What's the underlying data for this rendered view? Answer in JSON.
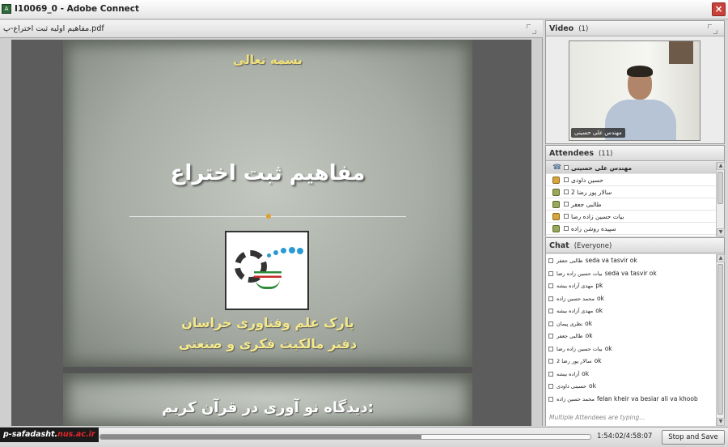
{
  "window": {
    "title": "I10069_0 - Adobe Connect",
    "icon": "adobe-connect-icon",
    "close_label": "×"
  },
  "share_pod": {
    "title": "مفاهیم اولیه ثبت اختراع-پ.pdf",
    "slide1": {
      "bismillah": "بسمه تعالی",
      "title": "مفاهیم ثبت اختراع",
      "org_line1": "پارک علم وفناوری خراسان",
      "org_line2": "دفتر مالکیت فکری و صنعتی"
    },
    "slide2": {
      "title": "دیدگاه نو آوری در قرآن کریم:"
    }
  },
  "video_pod": {
    "title": "Video",
    "count": "(1)",
    "video_label": "مهندس علی حسینی"
  },
  "attendees_pod": {
    "title": "Attendees",
    "count": "(11)",
    "items": [
      {
        "name": "مهندس علی حسینی",
        "icon": "phone-icon",
        "host": true
      },
      {
        "name": "حسین داودی",
        "icon": "user-icon"
      },
      {
        "name": "سالار پور رضا 2",
        "icon": "camera-user-icon"
      },
      {
        "name": "طالبی جعفر",
        "icon": "camera-user-icon"
      },
      {
        "name": "بیات حسین زاده رضا",
        "icon": "user-icon"
      },
      {
        "name": "سپیده روشن زاده",
        "icon": "camera-user-icon"
      }
    ]
  },
  "chat_pod": {
    "title": "Chat",
    "scope": "(Everyone)",
    "messages": [
      {
        "name": "طالبی جعفر",
        "text": "seda va tasvir ok"
      },
      {
        "name": "بیات حسین زاده رضا",
        "text": "seda va tasvir  ok"
      },
      {
        "name": "مهدی آزاده بیشه",
        "text": "pk"
      },
      {
        "name": "محمد حسین زاده",
        "text": "ok"
      },
      {
        "name": "مهدی آزاده بیشه",
        "text": "ok"
      },
      {
        "name": "نظری پیمان",
        "text": "ok"
      },
      {
        "name": "طالبی جعفر",
        "text": "ok"
      },
      {
        "name": "بیات حسین زاده رضا",
        "text": "ok"
      },
      {
        "name": "سالار پور رضا 2",
        "text": "ok"
      },
      {
        "name": "آزاده بیشه",
        "text": "ok"
      },
      {
        "name": "حسینی داودی",
        "text": "ok"
      },
      {
        "name": "محمد حسین زاده",
        "text": "felan kheir va besiar ali va khoob"
      }
    ],
    "typing_status": "Multiple Attendees are typing..."
  },
  "status_bar": {
    "watermark_user": "p-safadasht.",
    "watermark_domain": "nus.ac.ir",
    "progress_fraction": 0.655,
    "time": "1:54:02/4:58:07",
    "stop_button": "Stop and Save"
  }
}
